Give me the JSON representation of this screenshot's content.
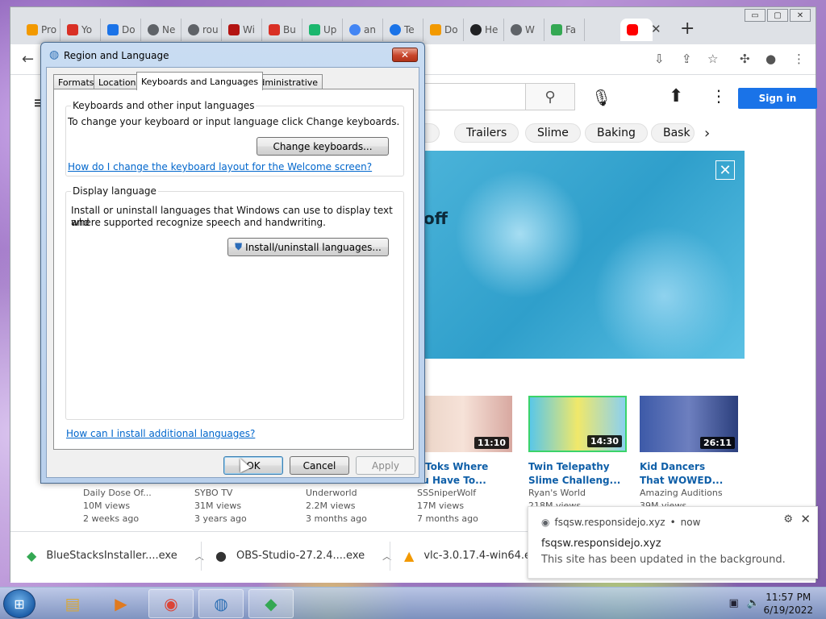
{
  "chrome": {
    "tabs": [
      {
        "label": "Pro",
        "color": "#f29900"
      },
      {
        "label": "Yo",
        "color": "#d93025"
      },
      {
        "label": "Do",
        "color": "#1a73e8"
      },
      {
        "label": "Ne",
        "color": "#5f6368"
      },
      {
        "label": "rou",
        "color": "#5f6368"
      },
      {
        "label": "Wi",
        "color": "#b31412"
      },
      {
        "label": "Bu",
        "color": "#d93025"
      },
      {
        "label": "Up",
        "color": "#1bb76e"
      },
      {
        "label": "an",
        "color": "#4285f4"
      },
      {
        "label": "Te",
        "color": "#1a73e8"
      },
      {
        "label": "Do",
        "color": "#f29900"
      },
      {
        "label": "He",
        "color": "#202124"
      },
      {
        "label": "W",
        "color": "#5f6368"
      },
      {
        "label": "Fa",
        "color": "#34a853"
      },
      {
        "label": "",
        "color": "#ff0000"
      }
    ],
    "new_tab": "+",
    "close_tab": "✕",
    "win": {
      "min": "▭",
      "max": "▢",
      "close": "✕"
    }
  },
  "youtube": {
    "sign_in": "Sign in",
    "chips": [
      "Trailers",
      "Slime",
      "Baking",
      "Bask"
    ],
    "banner_text": "off",
    "banner_close": "✕",
    "videos": [
      {
        "title": "k Toks Where",
        "title2": "ou Have To...",
        "channel": "SSSniperWolf",
        "views": "17M views",
        "age": "7 months ago",
        "duration": "11:10"
      },
      {
        "title": "Twin Telepathy",
        "title2": "Slime Challeng...",
        "channel": "Ryan's World",
        "views": "218M views",
        "age": "",
        "duration": "14:30"
      },
      {
        "title": "Kid Dancers",
        "title2": "That WOWED...",
        "channel": "Amazing Auditions",
        "views": "39M views",
        "age": "",
        "duration": "26:11"
      }
    ],
    "hidden_rows": [
      {
        "channel": "Daily Dose Of...",
        "views": "10M views",
        "age": "2 weeks ago"
      },
      {
        "channel": "SYBO TV",
        "views": "31M views",
        "age": "3 years ago"
      },
      {
        "channel": "Underworld",
        "views": "2.2M views",
        "age": "3 months ago"
      }
    ]
  },
  "downloads": [
    {
      "name": "BlueStacksInstaller....exe"
    },
    {
      "name": "OBS-Studio-27.2.4....exe"
    },
    {
      "name": "vlc-3.0.17.4-win64.exe"
    }
  ],
  "notification": {
    "source": "fsqsw.responsidejo.xyz",
    "time": "now",
    "title": "fsqsw.responsidejo.xyz",
    "body": "This site has been updated in the background."
  },
  "dialog": {
    "title": "Region and Language",
    "tabs": [
      "Formats",
      "Location",
      "Keyboards and Languages",
      "Administrative"
    ],
    "group1": {
      "legend": "Keyboards and other input languages",
      "text": "To change your keyboard or input language click Change keyboards.",
      "button": "Change keyboards...",
      "link": "How do I change the keyboard layout for the Welcome screen?"
    },
    "group2": {
      "legend": "Display language",
      "text1": "Install or uninstall languages that Windows can use to display text and",
      "text2": "where supported recognize speech and handwriting.",
      "button": "Install/uninstall languages..."
    },
    "bottom_link": "How can I install additional languages?",
    "ok": "OK",
    "cancel": "Cancel",
    "apply": "Apply"
  },
  "taskbar": {
    "time": "11:57 PM",
    "date": "6/19/2022"
  }
}
